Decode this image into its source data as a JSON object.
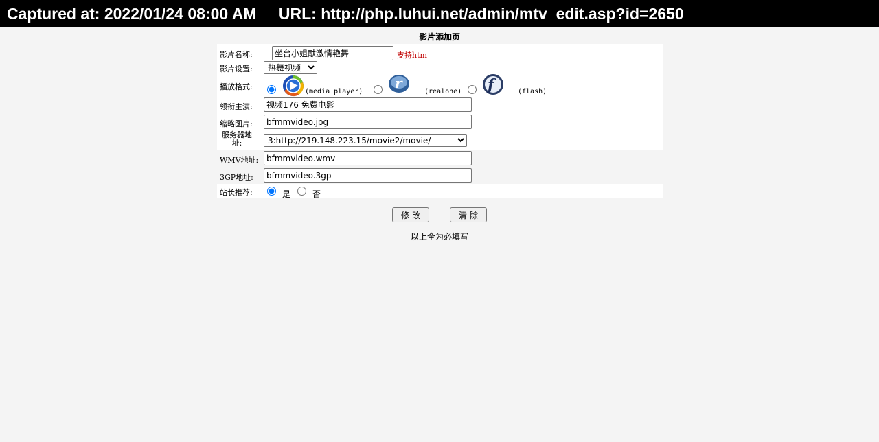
{
  "capture": {
    "timestamp": "Captured at: 2022/01/24 08:00 AM",
    "url": "URL: http://php.luhui.net/admin/mtv_edit.asp?id=2650"
  },
  "page": {
    "title": "影片添加页",
    "footnote": "以上全为必填写"
  },
  "form": {
    "name": {
      "label": "影片名称:",
      "value": "坐台小姐献激情艳舞",
      "hint": "支持htm"
    },
    "category": {
      "label": "影片设置:",
      "selected": "热舞视频"
    },
    "format": {
      "label": "播放格式:",
      "options": [
        {
          "icon": "media-player-icon",
          "label": "(media player)",
          "checked": true
        },
        {
          "icon": "realone-icon",
          "label": "(realone)",
          "checked": false
        },
        {
          "icon": "flash-icon",
          "label": "(flash)",
          "checked": false
        }
      ]
    },
    "lead_actor": {
      "label": "领衔主演:",
      "value": "视频176 免费电影"
    },
    "thumbnail": {
      "label": "缩略图片:",
      "value": "bfmmvideo.jpg"
    },
    "server": {
      "label": "服务器地址:",
      "selected": "3:http://219.148.223.15/movie2/movie/"
    },
    "wmv": {
      "label": "WMV地址:",
      "value": "bfmmvideo.wmv"
    },
    "gp3": {
      "label": "3GP地址:",
      "value": "bfmmvideo.3gp"
    },
    "recommend": {
      "label": "站长推荐:",
      "options": [
        {
          "label": "是",
          "checked": true
        },
        {
          "label": "否",
          "checked": false
        }
      ]
    }
  },
  "buttons": {
    "submit": "修改",
    "clear": "清除"
  }
}
